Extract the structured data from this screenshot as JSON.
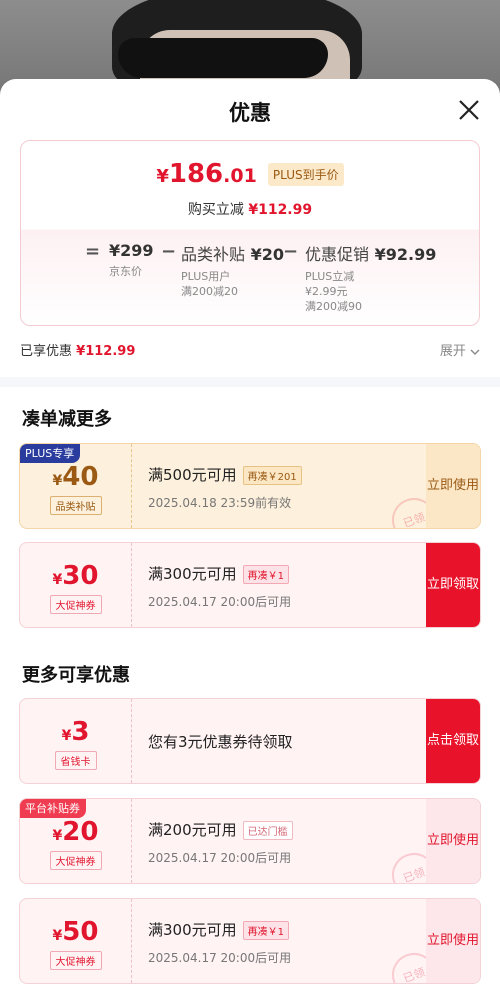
{
  "header": {
    "title": "优惠"
  },
  "summary": {
    "price_symbol": "¥",
    "price_int": "186",
    "price_dec": ".01",
    "price_tag": "PLUS到手价",
    "buy_label": "购买立减",
    "buy_amount": "¥112.99",
    "formula": {
      "eq": "=",
      "jd_price": "¥299",
      "jd_price_label": "京东价",
      "minus1": "−",
      "subsidy_label": "品类补贴",
      "subsidy_amount": "¥20",
      "subsidy_sub1": "PLUS用户",
      "subsidy_sub2": "满200减20",
      "minus2": "−",
      "promo_label": "优惠促销",
      "promo_amount": "¥92.99",
      "promo_sub1": "PLUS立减",
      "promo_sub2": "¥2.99元",
      "promo_sub3": "满200减90"
    },
    "enjoyed_label": "已享优惠",
    "enjoyed_amount": "¥112.99",
    "expand_label": "展开"
  },
  "section1": {
    "title": "凑单减更多"
  },
  "section2": {
    "title": "更多可享优惠"
  },
  "coupons": [
    {
      "corner": "PLUS专享",
      "yen": "¥",
      "amount": "40",
      "tag": "品类补贴",
      "condition": "满500元可用",
      "chip": "再凑￥201",
      "date": "2025.04.18 23:59前有效",
      "button": "立即使用",
      "stamp": "已领"
    },
    {
      "yen": "¥",
      "amount": "30",
      "tag": "大促神券",
      "condition": "满300元可用",
      "chip": "再凑￥1",
      "date": "2025.04.17 20:00后可用",
      "button": "立即领取"
    },
    {
      "yen": "¥",
      "amount": "3",
      "tag": "省钱卡",
      "desc": "您有3元优惠券待领取",
      "button": "点击领取"
    },
    {
      "corner": "平台补贴券",
      "yen": "¥",
      "amount": "20",
      "tag": "大促神券",
      "condition": "满200元可用",
      "chip": "已达门槛",
      "date": "2025.04.17 20:00后可用",
      "button": "立即使用",
      "stamp": "已领"
    },
    {
      "yen": "¥",
      "amount": "50",
      "tag": "大促神券",
      "condition": "满300元可用",
      "chip": "再凑￥1",
      "date": "2025.04.17 20:00后可用",
      "button": "立即使用",
      "stamp": "已领"
    }
  ],
  "colors": {
    "accent_red": "#e1162e",
    "gold": "#9a5a14",
    "plus_blue": "#2a3d9e"
  }
}
